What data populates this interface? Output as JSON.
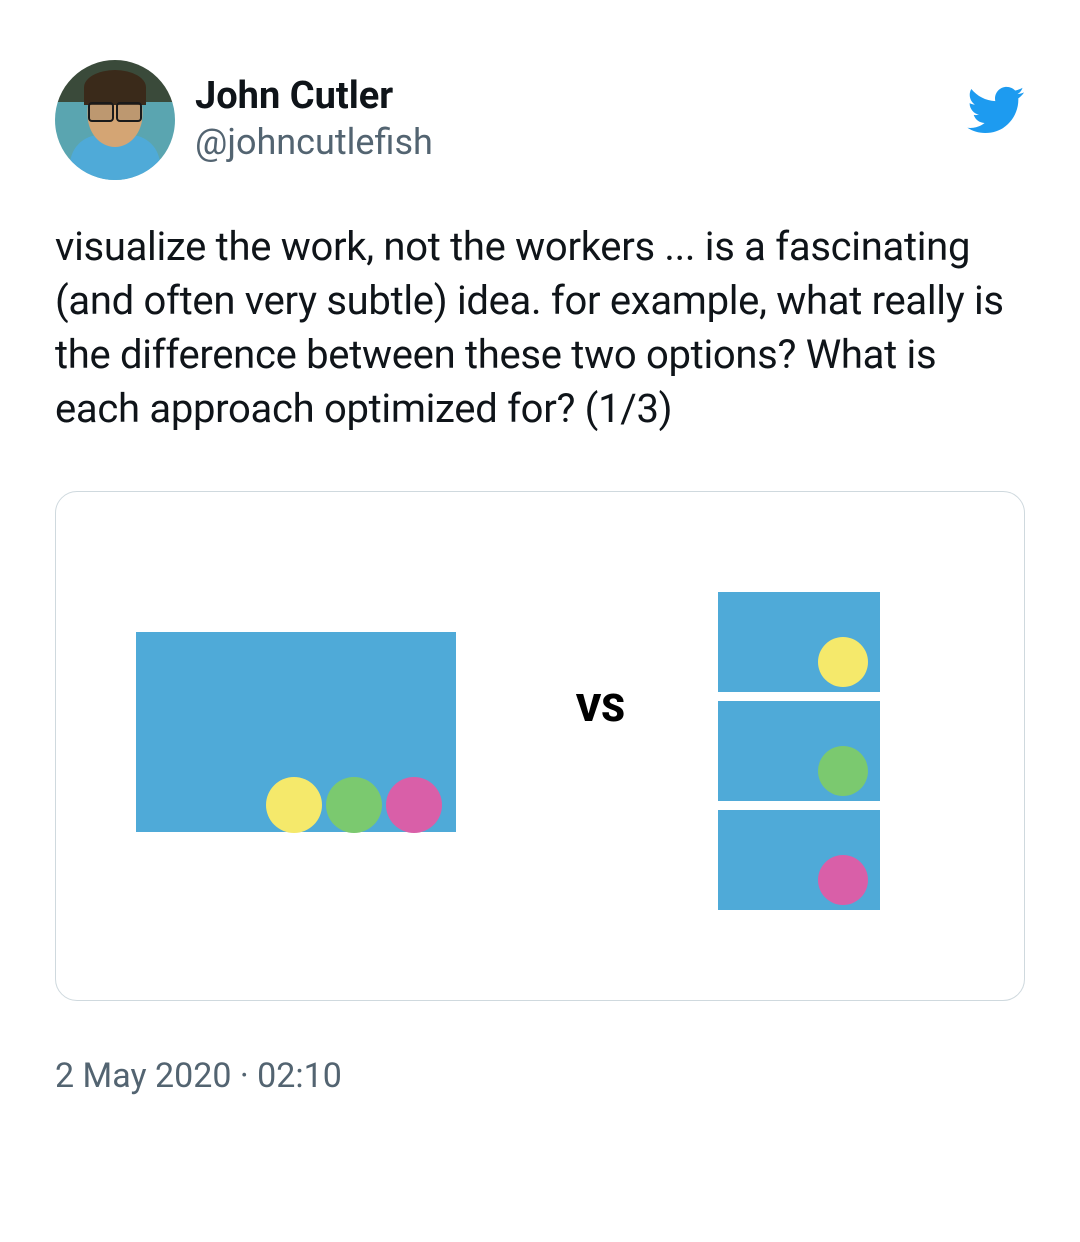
{
  "author": {
    "display_name": "John Cutler",
    "username": "@johncutlefish"
  },
  "tweet": {
    "text": "visualize the work, not the workers ... is a fascinating (and often very subtle) idea. for example, what really is the difference between these two options? What is each approach optimized for? (1/3)"
  },
  "media": {
    "vs_label": "VS",
    "colors": {
      "block": "#4faad8",
      "yellow": "#f5e96b",
      "green": "#7bc96f",
      "pink": "#d95fa8"
    }
  },
  "timestamp": "2 May 2020 · 02:10"
}
